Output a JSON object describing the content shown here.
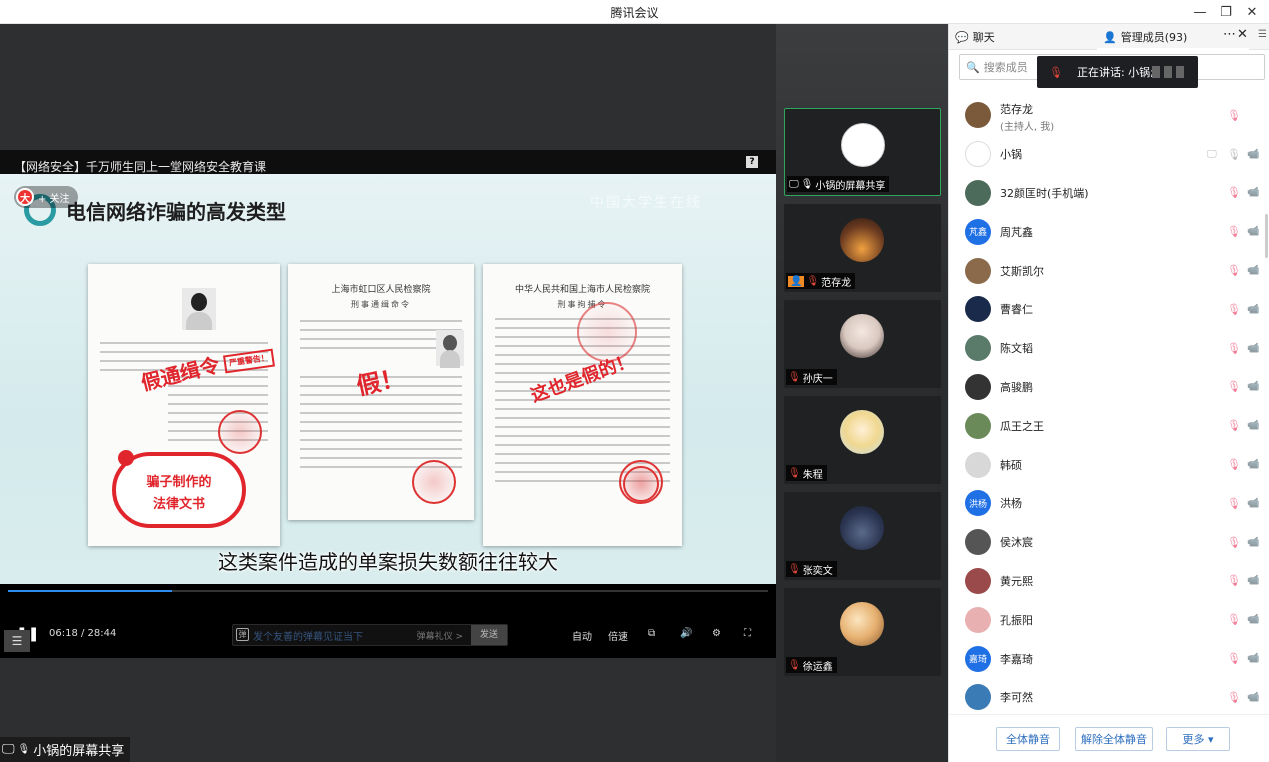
{
  "window": {
    "title": "腾讯会议"
  },
  "video": {
    "title": "【网络安全】千万师生同上一堂网络安全教育课",
    "help_label": "?",
    "follow_label": "+ 关注",
    "slide_title": "电信网络诈骗的高发类型",
    "watermark": "中国大学生在线",
    "doc2_head": "上海市虹口区人民检察院",
    "doc2_sub": "刑事通缉命令",
    "doc3_head": "中华人民共和国上海市人民检察院",
    "doc3_sub": "刑事拘捕令",
    "stamp1": "假通缉令",
    "stamp2": "假！",
    "stamp3": "这也是假的！",
    "warning_stamp": "严重警告！",
    "cloud_text": "骗子制作的\n法律文书",
    "subtitle": "这类案件造成的单案损失数额往往较大",
    "progress_fraction": 0.216,
    "time": "06:18 / 28:44",
    "danmu_placeholder": "发个友善的弹幕见证当下",
    "danmu_etiquette": "弹幕礼仪 >",
    "danmu_send": "发送",
    "auto": "自动",
    "speed": "倍速"
  },
  "share_label": "小锅的屏幕共享",
  "gallery": [
    {
      "name": "小锅的屏幕共享",
      "mic": "on",
      "active": true
    },
    {
      "name": "范存龙",
      "mic": "off",
      "host": true
    },
    {
      "name": "孙庆一",
      "mic": "off"
    },
    {
      "name": "朱程",
      "mic": "off"
    },
    {
      "name": "张奕文",
      "mic": "off"
    },
    {
      "name": "徐运鑫",
      "mic": "off"
    }
  ],
  "panel": {
    "tab_chat": "聊天",
    "tab_members": "管理成员(93)",
    "search_placeholder": "搜索成员",
    "speaking": "正在讲话: 小锅;",
    "members": [
      {
        "name": "范存龙",
        "sub": "(主持人, 我)",
        "avatar_color": "#7a5a3a"
      },
      {
        "name": "小锅",
        "avatar_color": "#ffffff"
      },
      {
        "name": "32颜匡时(手机端)",
        "avatar_color": "#4d6b5a"
      },
      {
        "name": "周芃鑫",
        "avatar_text": "芃鑫",
        "avatar_color": "#1f6fe5"
      },
      {
        "name": "艾斯凯尔",
        "avatar_color": "#8a6a4a"
      },
      {
        "name": "曹睿仁",
        "avatar_color": "#1a2a4a"
      },
      {
        "name": "陈文韬",
        "avatar_color": "#5a7a6a"
      },
      {
        "name": "高骏鹏",
        "avatar_color": "#333333"
      },
      {
        "name": "瓜王之王",
        "avatar_color": "#6a8a5a"
      },
      {
        "name": "韩硕",
        "avatar_color": "#d8d8d8"
      },
      {
        "name": "洪杨",
        "avatar_text": "洪杨",
        "avatar_color": "#1f6fe5"
      },
      {
        "name": "侯沐宸",
        "avatar_color": "#555555"
      },
      {
        "name": "黄元熙",
        "avatar_color": "#9a4a4a"
      },
      {
        "name": "孔振阳",
        "avatar_color": "#e8b0b0"
      },
      {
        "name": "李嘉琦",
        "avatar_text": "嘉琦",
        "avatar_color": "#1f6fe5"
      },
      {
        "name": "李可然",
        "avatar_color": "#3a7ab5"
      }
    ],
    "btn_mute_all": "全体静音",
    "btn_unmute_all": "解除全体静音",
    "btn_more": "更多 ▾"
  }
}
